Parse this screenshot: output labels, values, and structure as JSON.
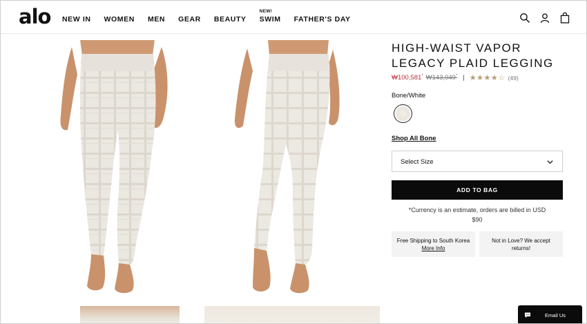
{
  "brand": {
    "logo_text": "alo"
  },
  "nav": {
    "items": [
      {
        "label": "NEW IN",
        "badge": ""
      },
      {
        "label": "WOMEN",
        "badge": ""
      },
      {
        "label": "MEN",
        "badge": ""
      },
      {
        "label": "GEAR",
        "badge": ""
      },
      {
        "label": "BEAUTY",
        "badge": ""
      },
      {
        "label": "SWIM",
        "badge": "NEW!"
      },
      {
        "label": "FATHER'S DAY",
        "badge": ""
      }
    ],
    "icons": [
      "search-icon",
      "account-icon",
      "bag-icon"
    ]
  },
  "product": {
    "title_line1": "HIGH-WAIST VAPOR",
    "title_line2": "LEGACY PLAID LEGGING",
    "price_sale": "₩100,581",
    "price_sale_mark": "*",
    "price_original": "₩143,049",
    "price_original_mark": "*",
    "separator": "|",
    "rating": 4,
    "rating_max": 5,
    "review_count": "(49)",
    "color_name": "Bone/White",
    "shop_all_label": "Shop All Bone",
    "size_placeholder": "Select Size",
    "add_to_bag_label": "ADD TO BAG",
    "currency_note_line1": "*Currency is an estimate, orders are billed in USD",
    "currency_note_line2": "$90"
  },
  "info": {
    "shipping_text": "Free Shipping to South Korea",
    "shipping_link": "More Info",
    "returns_line1": "Not in Love? We accept",
    "returns_line2": "returns!"
  },
  "chat": {
    "label": "Email Us"
  },
  "colors": {
    "sale": "#c22a3a",
    "star": "#b49a74",
    "button": "#0b0b0b",
    "info_bg": "#f3f3f3"
  }
}
